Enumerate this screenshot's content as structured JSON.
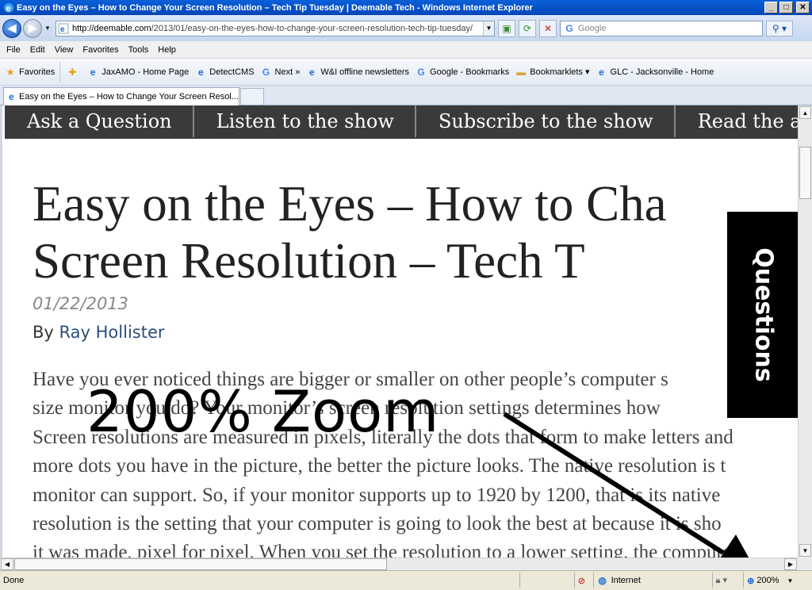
{
  "window": {
    "title": "Easy on the Eyes – How to Change Your Screen Resolution – Tech Tip Tuesday | Deemable Tech - Windows Internet Explorer",
    "min": "_",
    "max": "□",
    "close": "✕"
  },
  "address": {
    "url_prefix": "http://deemable.com",
    "url_path": "/2013/01/easy-on-the-eyes-how-to-change-your-screen-resolution-tech-tip-tuesday/",
    "search_placeholder": "Google"
  },
  "menu": [
    "File",
    "Edit",
    "View",
    "Favorites",
    "Tools",
    "Help"
  ],
  "favorites": {
    "label": "Favorites",
    "items": [
      {
        "label": "JaxAMO - Home Page",
        "icon": "ie-page-icon"
      },
      {
        "label": "DetectCMS",
        "icon": "ie-page-icon"
      },
      {
        "label": "Next »",
        "icon": "google-icon"
      },
      {
        "label": "W&I offline newsletters",
        "icon": "ie-page-icon"
      },
      {
        "label": "Google - Bookmarks",
        "icon": "google-icon"
      },
      {
        "label": "Bookmarklets ▾",
        "icon": "folder-icon"
      },
      {
        "label": "GLC - Jacksonville - Home",
        "icon": "ie-page-icon"
      }
    ]
  },
  "tab": {
    "label": "Easy on the Eyes – How to Change Your Screen Resol..."
  },
  "site_nav": [
    "Ask a Question",
    "Listen to the show",
    "Subscribe to the show",
    "Read the articles"
  ],
  "article": {
    "title_line1": "Easy on the Eyes – How to Cha",
    "title_line2": "Screen Resolution – Tech T",
    "date": "01/22/2013",
    "by": "By",
    "author": "Ray Hollister",
    "body": [
      "Have you ever noticed things are bigger or smaller on other people’s computer s",
      "size monitor you do? Your monitor’s screen resolution settings determines how",
      "Screen resolutions are measured in pixels, literally the dots that form to make letters and",
      "more dots you have in the picture, the better the picture looks. The native resolution is t",
      "monitor can support. So, if your monitor supports up to 1920 by 1200, that is its native",
      "resolution is the setting that your computer is going to look the best at because it is sho",
      "it was made, pixel for pixel. When you set the resolution to a lower setting, the compute"
    ]
  },
  "questions_tab": "Questions",
  "overlay": {
    "zoom_text": "200%  Zoom"
  },
  "status": {
    "text": "Done",
    "zone": "Internet",
    "zoom": "200%"
  }
}
